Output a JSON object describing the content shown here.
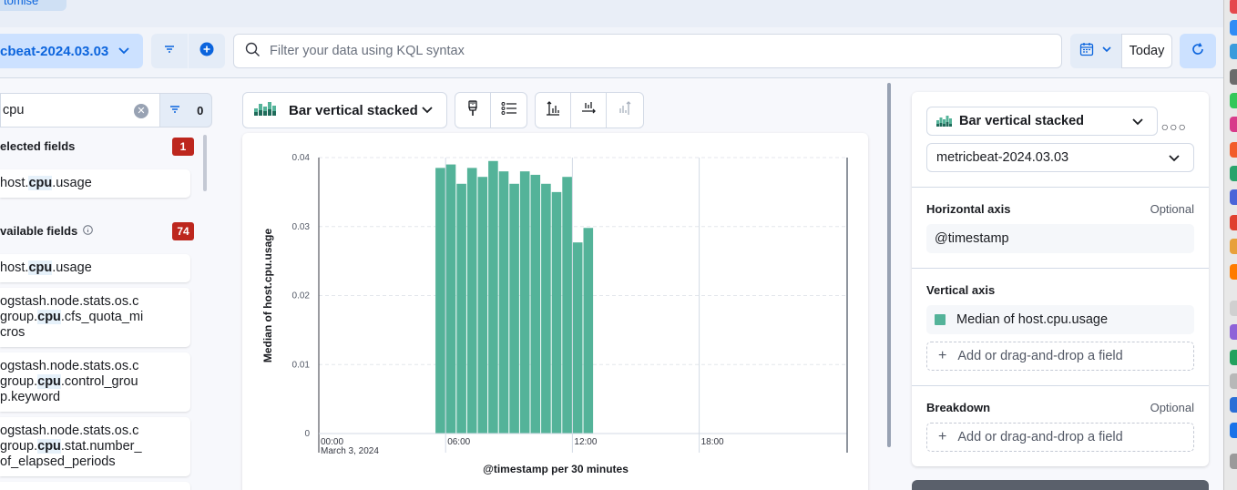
{
  "top_tab": {
    "label": "tomise"
  },
  "query_bar": {
    "data_view": "cbeat-2024.03.03",
    "search_placeholder": "Filter your data using KQL syntax",
    "date_label": "Today"
  },
  "sidebar": {
    "search_value": "cpu",
    "filter_count": "0",
    "selected_fields": {
      "title": "elected fields",
      "count": "1"
    },
    "selected_items": [
      {
        "pre": "host.",
        "match": "cpu",
        "post": ".usage"
      }
    ],
    "available_fields": {
      "title": "vailable fields",
      "count": "74"
    },
    "available_items": [
      {
        "pre": "host.",
        "match": "cpu",
        "post": ".usage"
      },
      {
        "pre": "ogstash.node.stats.os.c group.",
        "match": "cpu",
        "post": ".cfs_quota_mi cros"
      },
      {
        "pre": "ogstash.node.stats.os.c group.",
        "match": "cpu",
        "post": ".control_grou p.keyword"
      },
      {
        "pre": "ogstash.node.stats.os.c group.",
        "match": "cpu",
        "post": ".stat.number_ of_elapsed_periods"
      }
    ]
  },
  "workspace": {
    "chart_type_label": "Bar vertical stacked"
  },
  "config_panel": {
    "chart_type": "Bar vertical stacked",
    "data_view": "metricbeat-2024.03.03",
    "horizontal_axis": {
      "label": "Horizontal axis",
      "optional": "Optional",
      "field": "@timestamp"
    },
    "vertical_axis": {
      "label": "Vertical axis",
      "field": "Median of host.cpu.usage",
      "add": "Add or drag-and-drop a field"
    },
    "breakdown": {
      "label": "Breakdown",
      "optional": "Optional",
      "add": "Add or drag-and-drop a field"
    }
  },
  "colors": {
    "bar": "#54b399",
    "accent": "#0b64dd",
    "badge": "#bd271e"
  },
  "chart_data": {
    "type": "bar",
    "xlabel": "@timestamp per 30 minutes",
    "ylabel": "Median of host.cpu.usage",
    "ylim": [
      0,
      0.04
    ],
    "yticks": [
      "0",
      "0.01",
      "0.02",
      "0.03",
      "0.04"
    ],
    "xticks": [
      {
        "hour": 0,
        "label": "00:00",
        "sub": "March 3, 2024"
      },
      {
        "hour": 6,
        "label": "06:00"
      },
      {
        "hour": 12,
        "label": "12:00"
      },
      {
        "hour": 18,
        "label": "18:00"
      }
    ],
    "xlim_hours": [
      0,
      25
    ],
    "series": [
      {
        "name": "Median of host.cpu.usage",
        "x_hours": [
          5.5,
          6.0,
          6.5,
          7.0,
          7.5,
          8.0,
          8.5,
          9.0,
          9.5,
          10.0,
          10.5,
          11.0,
          11.5,
          12.0,
          12.5
        ],
        "values": [
          0.0385,
          0.039,
          0.0362,
          0.0385,
          0.0372,
          0.0395,
          0.038,
          0.0362,
          0.038,
          0.0375,
          0.0362,
          0.035,
          0.0372,
          0.0277,
          0.0298
        ]
      }
    ],
    "last_value_marker_hour": 25
  }
}
